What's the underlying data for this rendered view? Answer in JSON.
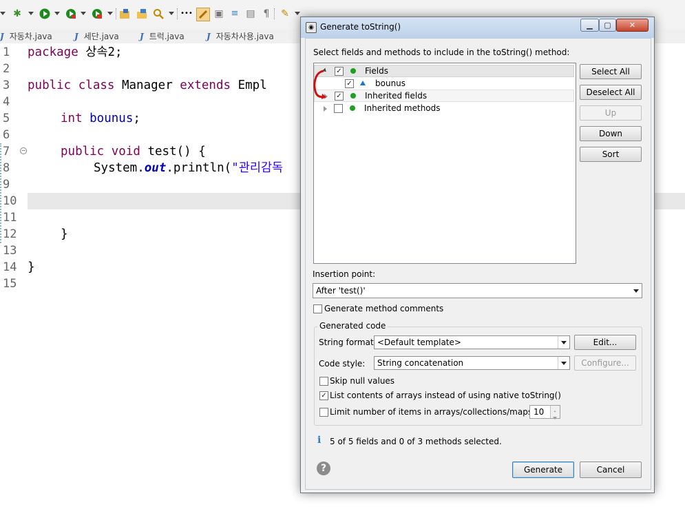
{
  "toolbar": {
    "icons": [
      "debug-icon",
      "run-icon",
      "run-coverage-icon",
      "external-tools-icon",
      "new-java-project-icon",
      "open-type-icon",
      "search-icon",
      "toggle-breadcrumb-icon",
      "mark-occurrences-icon",
      "block-selection-icon",
      "word-wrap-icon",
      "show-whitespace-icon",
      "paragraph-icon",
      "next-annotation-icon",
      "last-edit-icon",
      "back-icon",
      "forward-icon"
    ],
    "colors": {
      "debug": "#3d8f2f",
      "run": "#1e8a1e",
      "search": "#c08a00",
      "accent": "#f0a030"
    }
  },
  "tabs": [
    {
      "label": "자동차.java"
    },
    {
      "label": "세단.java"
    },
    {
      "label": "트럭.java"
    },
    {
      "label": "자동차사용.java"
    }
  ],
  "editor": {
    "line_numbers": [
      "1",
      "2",
      "3",
      "4",
      "5",
      "6",
      "7",
      "8",
      "9",
      "10",
      "11",
      "12",
      "13",
      "14",
      "15"
    ],
    "lines": {
      "l1_kw": "package",
      "l1_rest": " 상속2;",
      "l3_kw1": "public",
      "l3_kw2": "class",
      "l3_name": " Manager ",
      "l3_kw3": "extends",
      "l3_rest": " Empl",
      "l5_kw": "int",
      "l5_field": " bounus",
      "l5_rest": ";",
      "l7_kw1": "public",
      "l7_kw2": "void",
      "l7_rest": " test() {",
      "l8_a": "System.",
      "l8_out": "out",
      "l8_b": ".println(",
      "l8_str": "\"관리감독",
      "l12": "}",
      "l14": "}"
    },
    "current_line": "10"
  },
  "dialog": {
    "title": "Generate toString()",
    "instruction": "Select fields and methods to include in the toString() method:",
    "tree": [
      {
        "label": "Fields",
        "checked": true,
        "expanded": true
      },
      {
        "label": "bounus",
        "checked": true
      },
      {
        "label": "Inherited fields",
        "checked": true,
        "expanded": false
      },
      {
        "label": "Inherited methods",
        "checked": false,
        "expanded": false
      }
    ],
    "side_buttons": {
      "select_all": "Select All",
      "deselect_all": "Deselect All",
      "up": "Up",
      "down": "Down",
      "sort": "Sort"
    },
    "insertion_label": "Insertion point:",
    "insertion_value": "After 'test()'",
    "method_comments_label": "Generate method comments",
    "method_comments_checked": false,
    "generated_code_title": "Generated code",
    "string_format_label": "String format:",
    "string_format_value": "<Default template>",
    "edit_button": "Edit...",
    "code_style_label": "Code style:",
    "code_style_value": "String concatenation",
    "configure_button": "Configure...",
    "skip_null_label": "Skip null values",
    "skip_null_checked": false,
    "list_arrays_label": "List contents of arrays instead of using native toString()",
    "list_arrays_checked": true,
    "limit_label": "Limit number of items in arrays/collections/maps to",
    "limit_checked": false,
    "limit_value": "10",
    "status": "5 of 5 fields and 0 of 3 methods selected.",
    "generate_button": "Generate",
    "cancel_button": "Cancel"
  }
}
